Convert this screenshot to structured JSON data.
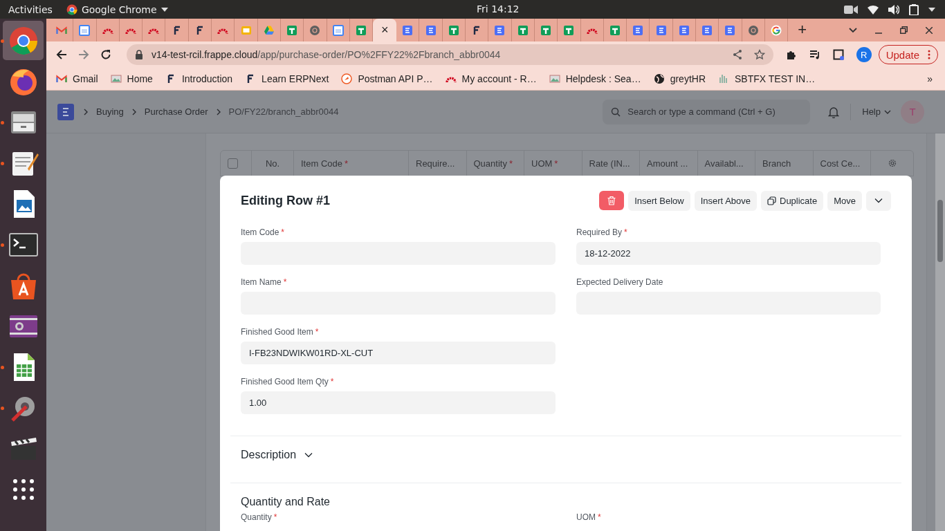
{
  "top_bar": {
    "activities": "Activities",
    "app": "Google Chrome",
    "clock": "Fri 14:12"
  },
  "dock": [
    {
      "kind": "chrome",
      "running": true,
      "selected": true
    },
    {
      "kind": "firefox",
      "running": false,
      "selected": false
    },
    {
      "kind": "files",
      "running": true,
      "selected": false
    },
    {
      "kind": "editor",
      "running": true,
      "selected": false
    },
    {
      "kind": "impress",
      "running": false,
      "selected": false
    },
    {
      "kind": "terminal",
      "running": true,
      "selected": false
    },
    {
      "kind": "store",
      "running": false,
      "selected": false
    },
    {
      "kind": "video",
      "running": false,
      "selected": false
    },
    {
      "kind": "calc",
      "running": true,
      "selected": false
    },
    {
      "kind": "tools",
      "running": true,
      "selected": false
    },
    {
      "kind": "clapper",
      "running": false,
      "selected": false
    },
    {
      "kind": "grid",
      "running": false,
      "selected": false
    }
  ],
  "browser": {
    "tabs": [
      {
        "kind": "gmail",
        "selected": false
      },
      {
        "kind": "calendar",
        "selected": false
      },
      {
        "kind": "arc",
        "selected": false
      },
      {
        "kind": "arc",
        "selected": false
      },
      {
        "kind": "arc",
        "selected": false
      },
      {
        "kind": "frappe",
        "selected": false
      },
      {
        "kind": "frappe",
        "selected": false
      },
      {
        "kind": "arc",
        "selected": false
      },
      {
        "kind": "slides",
        "selected": false
      },
      {
        "kind": "drive",
        "selected": false
      },
      {
        "kind": "sheet",
        "selected": false
      },
      {
        "kind": "chrome",
        "selected": false
      },
      {
        "kind": "calendar",
        "selected": false
      },
      {
        "kind": "sheet",
        "selected": false
      },
      {
        "kind": "blank",
        "selected": true,
        "close": "×"
      },
      {
        "kind": "erp",
        "selected": false
      },
      {
        "kind": "erp",
        "selected": false
      },
      {
        "kind": "sheet",
        "selected": false
      },
      {
        "kind": "frappe",
        "selected": false
      },
      {
        "kind": "erp",
        "selected": false
      },
      {
        "kind": "sheet",
        "selected": false
      },
      {
        "kind": "sheet",
        "selected": false
      },
      {
        "kind": "sheet",
        "selected": false
      },
      {
        "kind": "arc",
        "selected": false
      },
      {
        "kind": "sheet",
        "selected": false
      },
      {
        "kind": "erp",
        "selected": false
      },
      {
        "kind": "erp",
        "selected": false
      },
      {
        "kind": "erp",
        "selected": false
      },
      {
        "kind": "erp",
        "selected": false
      },
      {
        "kind": "erp",
        "selected": false
      },
      {
        "kind": "chrome",
        "selected": false
      },
      {
        "kind": "google",
        "selected": false
      }
    ],
    "new_tab": "+",
    "url_host": "v14-test-rcil.frappe.cloud",
    "url_path": "/app/purchase-order/PO%2FFY22%2Fbranch_abbr0044",
    "profile": "R",
    "update": "Update",
    "bookmarks": [
      {
        "kind": "gmail",
        "label": "Gmail"
      },
      {
        "kind": "image",
        "label": "Home"
      },
      {
        "kind": "frappe",
        "label": "Introduction"
      },
      {
        "kind": "frappe",
        "label": "Learn ERPNext"
      },
      {
        "kind": "postman",
        "label": "Postman API P…"
      },
      {
        "kind": "arc",
        "label": "My account - R…"
      },
      {
        "kind": "image",
        "label": "Helpdesk : Sea…"
      },
      {
        "kind": "globe",
        "label": "greytHR"
      },
      {
        "kind": "bars",
        "label": "SBTFX TEST IN…"
      }
    ],
    "bookmarks_more": "»"
  },
  "page": {
    "breadcrumbs": [
      "Buying",
      "Purchase Order",
      "PO/FY22/branch_abbr0044"
    ],
    "search": {
      "placeholder": "Search or type a command (Ctrl + G)"
    },
    "help": "Help",
    "avatar": "T",
    "table": {
      "select_all": {
        "checked": false
      },
      "columns": [
        {
          "label": "No."
        },
        {
          "label": "Item Code",
          "required": "*"
        },
        {
          "label": "Require..."
        },
        {
          "label": "Quantity",
          "required": "*"
        },
        {
          "label": "UOM",
          "required": "*"
        },
        {
          "label": "Rate (IN..."
        },
        {
          "label": "Amount ..."
        },
        {
          "label": "Availabl..."
        },
        {
          "label": "Branch"
        },
        {
          "label": "Cost Ce..."
        }
      ]
    },
    "dialog": {
      "title": "Editing Row #1",
      "actions": [
        "Insert Below",
        "Insert Above",
        "Duplicate",
        "Move"
      ],
      "fields_left": [
        {
          "label": "Item Code",
          "required": "*"
        },
        {
          "label": "Item Name",
          "required": "*"
        },
        {
          "label": "Finished Good Item",
          "required": "*",
          "value": "I-FB23NDWIKW01RD-XL-CUT"
        },
        {
          "label": "Finished Good Item Qty",
          "required": "*",
          "value": "1.00"
        }
      ],
      "fields_right": [
        {
          "label": "Required By",
          "required": "*",
          "value": "18-12-2022"
        },
        {
          "label": "Expected Delivery Date"
        }
      ],
      "sections": [
        {
          "title": "Description",
          "collapsible": true
        },
        {
          "title": "Quantity and Rate",
          "collapsible": false
        }
      ],
      "bottom_labels": [
        {
          "label": "Quantity",
          "required": "*"
        },
        {
          "label": "UOM",
          "required": "*"
        }
      ]
    }
  }
}
